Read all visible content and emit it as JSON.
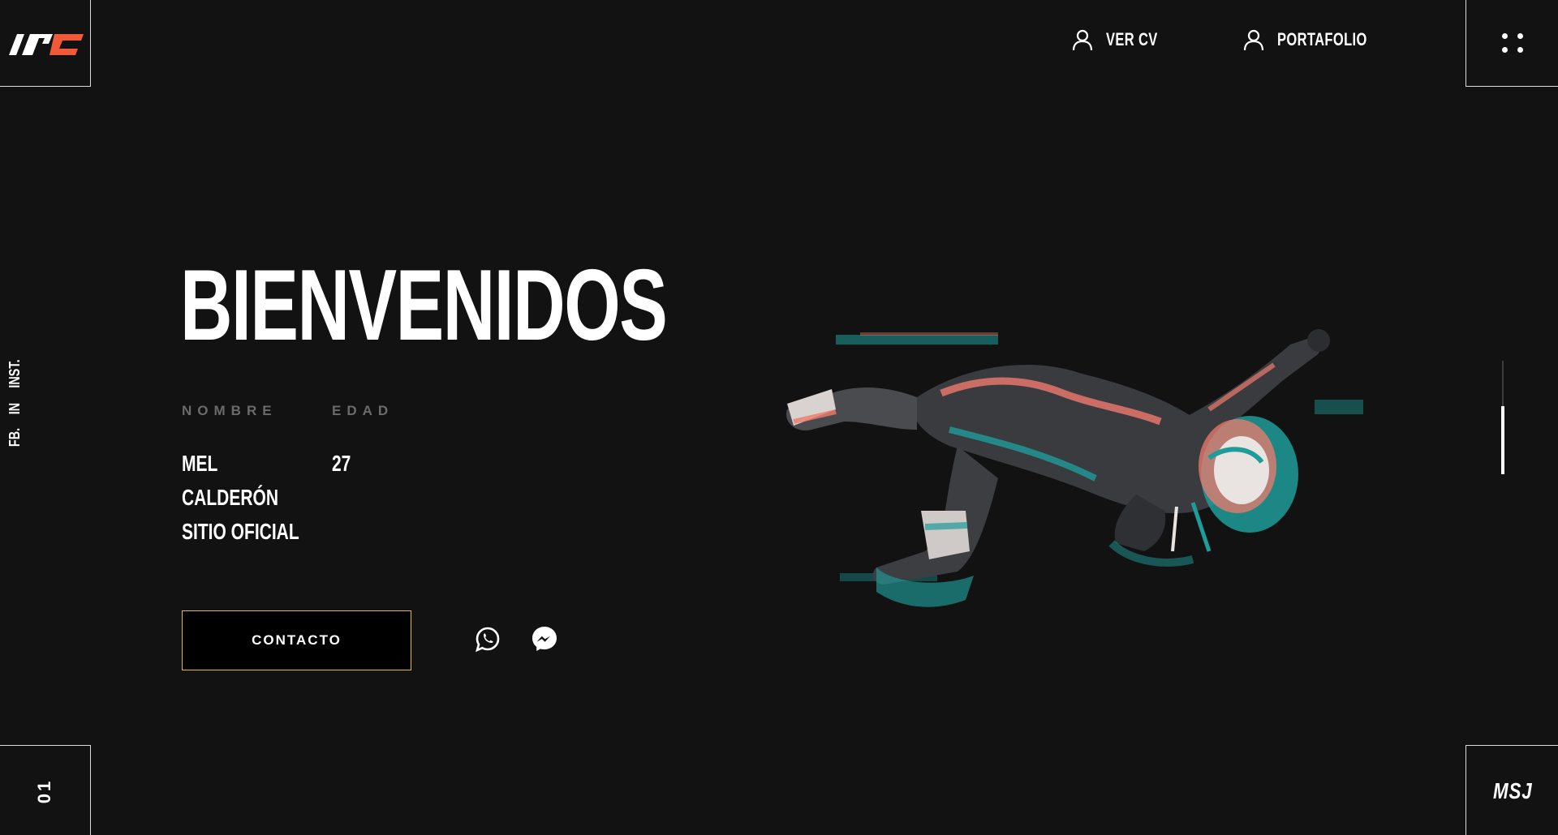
{
  "brand": {
    "logo_text": "MC",
    "accent": "#f05a38"
  },
  "nav": {
    "items": [
      {
        "label": "VER CV",
        "icon": "user-icon"
      },
      {
        "label": "PORTAFOLIO",
        "icon": "user-icon"
      }
    ],
    "menu_icon": "grid-dots-icon"
  },
  "social": [
    "FB.",
    "IN",
    "INST."
  ],
  "hero": {
    "title": "BIENVENIDOS",
    "name_label": "NOMBRE",
    "age_label": "EDAD",
    "name_lines": [
      "MEL",
      "CALDERÓN",
      "SITIO OFICIAL"
    ],
    "age": "27",
    "contact_label": "CONTACTO",
    "contact_border": "#e7b25a"
  },
  "messaging": {
    "whatsapp_icon": "whatsapp-icon",
    "messenger_icon": "messenger-icon"
  },
  "footer": {
    "page_number": "01",
    "message_label": "MSJ"
  },
  "scroll": {
    "position_fraction": 0.4
  },
  "colors": {
    "background": "#121213",
    "teal": "#1e9c9a",
    "coral": "#f07b6e"
  }
}
